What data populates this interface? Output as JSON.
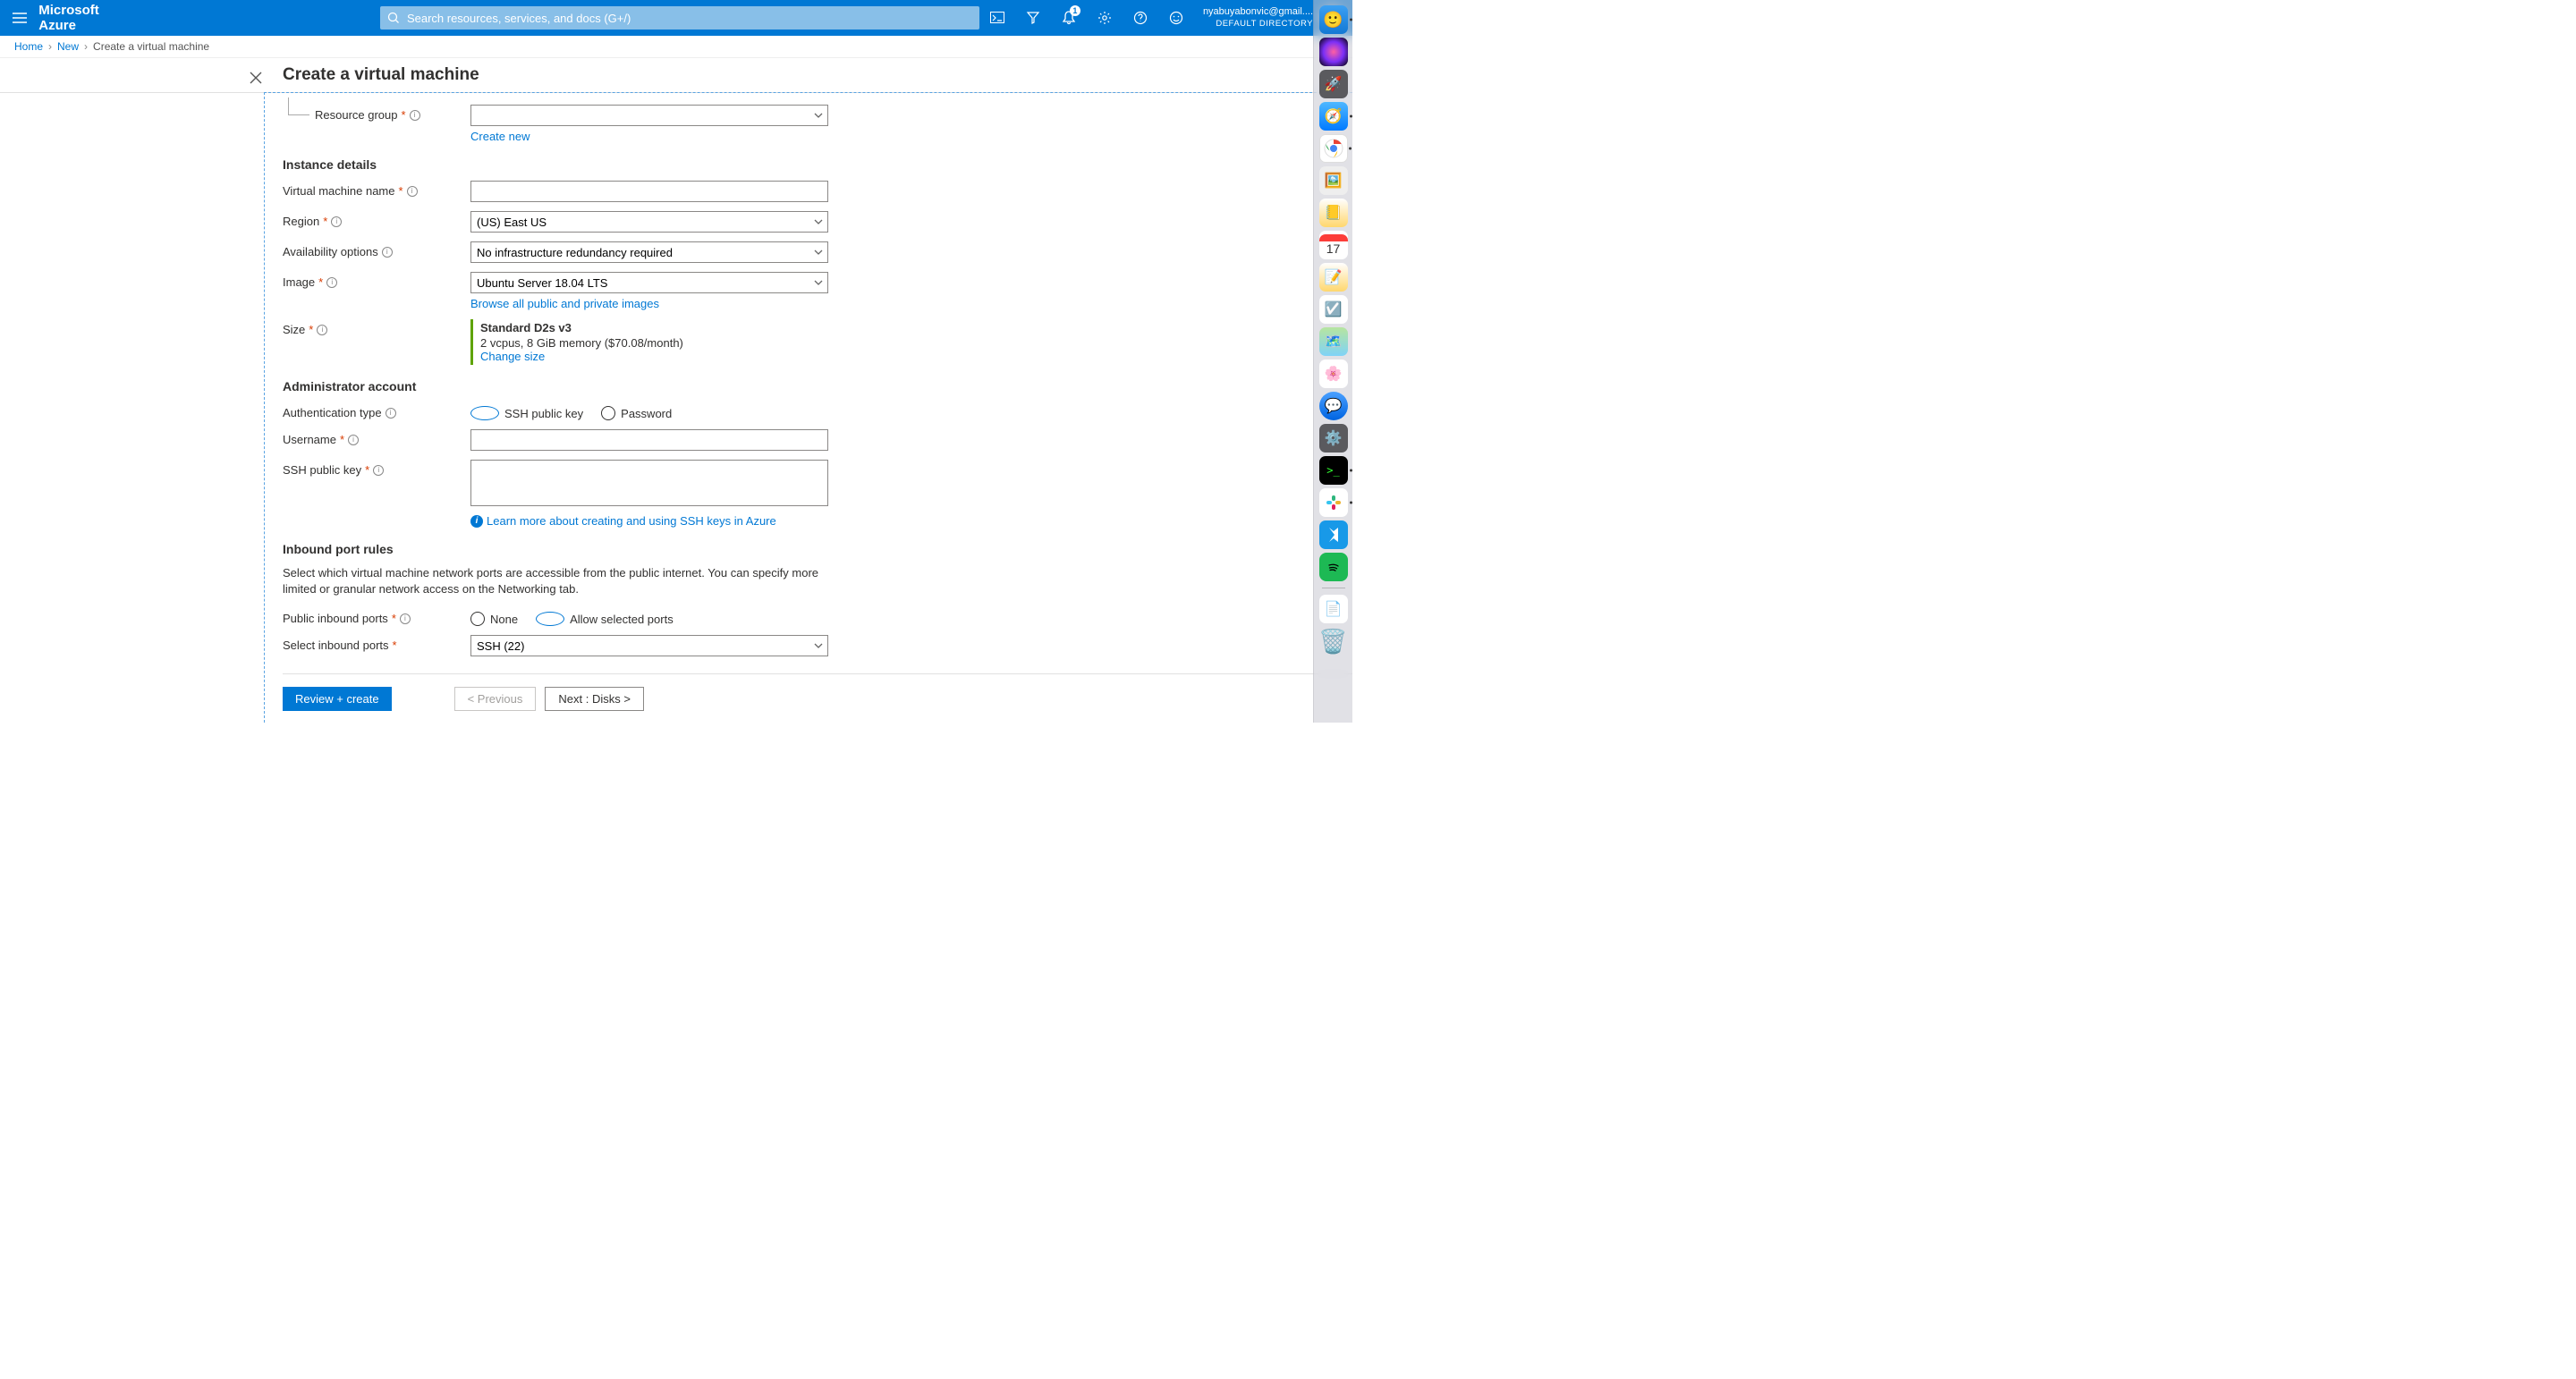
{
  "header": {
    "brand": "Microsoft Azure",
    "search_placeholder": "Search resources, services, and docs (G+/)",
    "notification_count": "1",
    "account_email": "nyabuyabonvic@gmail....",
    "account_directory": "DEFAULT DIRECTORY"
  },
  "breadcrumb": {
    "items": [
      "Home",
      "New",
      "Create a virtual machine"
    ]
  },
  "blade": {
    "title": "Create a virtual machine"
  },
  "form": {
    "resource_group": {
      "label": "Resource group",
      "value": "",
      "create_new": "Create new"
    },
    "sections": {
      "instance": {
        "heading": "Instance details",
        "vm_name": {
          "label": "Virtual machine name",
          "value": ""
        },
        "region": {
          "label": "Region",
          "value": "(US) East US"
        },
        "availability": {
          "label": "Availability options",
          "value": "No infrastructure redundancy required"
        },
        "image": {
          "label": "Image",
          "value": "Ubuntu Server 18.04 LTS",
          "browse": "Browse all public and private images"
        },
        "size": {
          "label": "Size",
          "name": "Standard D2s v3",
          "spec": "2 vcpus, 8 GiB memory ($70.08/month)",
          "change": "Change size"
        }
      },
      "admin": {
        "heading": "Administrator account",
        "auth_type": {
          "label": "Authentication type",
          "ssh": "SSH public key",
          "password": "Password"
        },
        "username": {
          "label": "Username",
          "value": ""
        },
        "ssh_key": {
          "label": "SSH public key",
          "value": "",
          "learn": "Learn more about creating and using SSH keys in Azure"
        }
      },
      "ports": {
        "heading": "Inbound port rules",
        "desc": "Select which virtual machine network ports are accessible from the public internet. You can specify more limited or granular network access on the Networking tab.",
        "public_ports": {
          "label": "Public inbound ports",
          "none": "None",
          "allow": "Allow selected ports"
        },
        "select_ports": {
          "label": "Select inbound ports",
          "value": "SSH (22)"
        }
      }
    }
  },
  "footer": {
    "review": "Review + create",
    "previous": "< Previous",
    "next": "Next : Disks >"
  },
  "dock": {
    "calendar_day": "17"
  }
}
